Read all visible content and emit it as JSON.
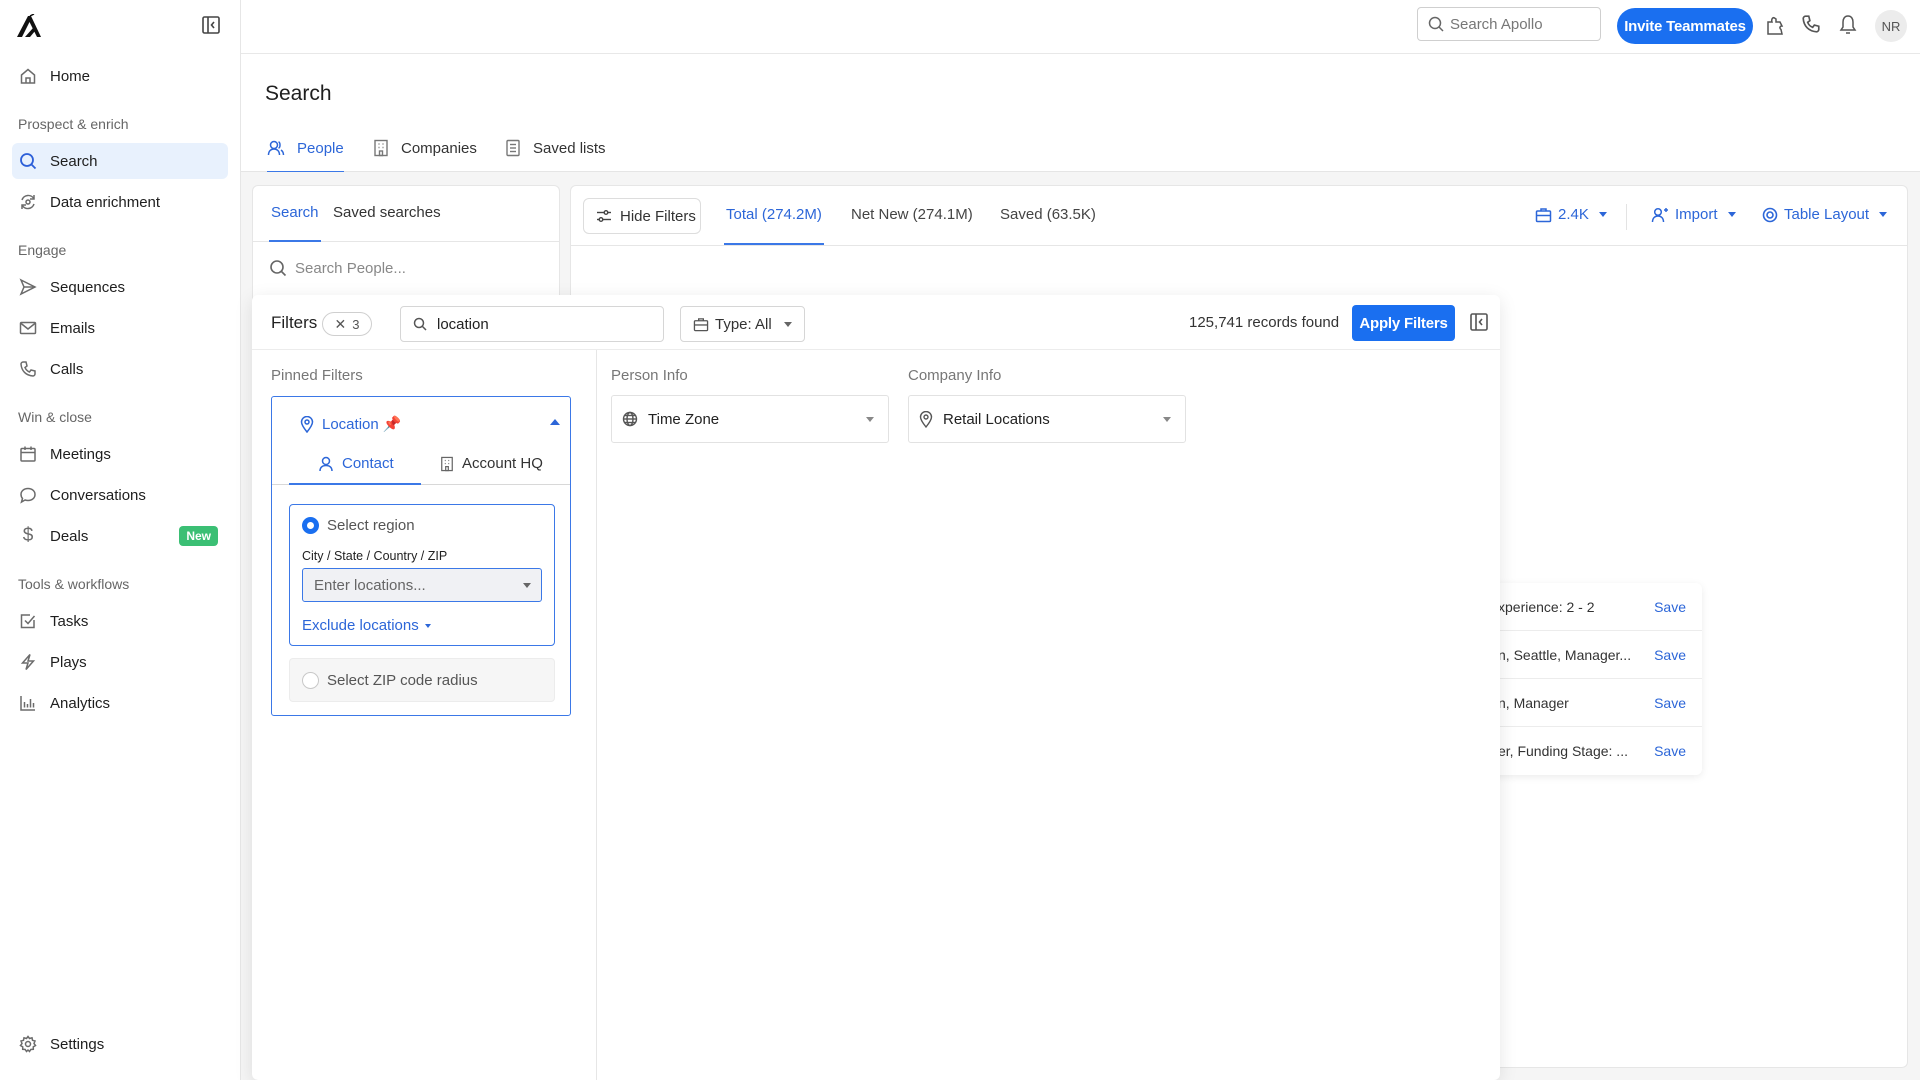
{
  "sidebar": {
    "collapse_label": "Collapse sidebar",
    "home": "Home",
    "sections": {
      "prospect": "Prospect & enrich",
      "engage": "Engage",
      "win": "Win & close",
      "tools": "Tools & workflows"
    },
    "items": {
      "search": "Search",
      "data_enrichment": "Data enrichment",
      "sequences": "Sequences",
      "emails": "Emails",
      "calls": "Calls",
      "meetings": "Meetings",
      "conversations": "Conversations",
      "deals": "Deals",
      "tasks": "Tasks",
      "plays": "Plays",
      "analytics": "Analytics",
      "settings": "Settings"
    },
    "deals_badge": "New",
    "active": "search"
  },
  "topbar": {
    "search_placeholder": "Search Apollo",
    "invite_label": "Invite Teammates",
    "avatar_initials": "NR"
  },
  "page": {
    "title": "Search",
    "tabs": [
      "People",
      "Companies",
      "Saved lists"
    ],
    "active_tab": "People"
  },
  "left_panel": {
    "tabs": [
      "Search",
      "Saved searches"
    ],
    "active_tab": "Search",
    "search_placeholder": "Search People..."
  },
  "toolbar": {
    "hide_filters": "Hide Filters",
    "views": [
      "Total (274.2M)",
      "Net New (274.1M)",
      "Saved (63.5K)"
    ],
    "active_view": "Total (274.2M)",
    "credits": "2.4K",
    "import": "Import",
    "table_layout": "Table Layout"
  },
  "saved_searches": [
    {
      "text": "xperience: 2 - 2",
      "action": "Save"
    },
    {
      "text": "n, Seattle, Manager...",
      "action": "Save"
    },
    {
      "text": "n, Manager",
      "action": "Save"
    },
    {
      "text": "er, Funding Stage: ...",
      "action": "Save"
    }
  ],
  "filters": {
    "title": "Filters",
    "count": "3",
    "search_value": "location",
    "type_label": "Type: All",
    "records_found": "125,741 records found",
    "apply_label": "Apply Filters",
    "pinned_label": "Pinned Filters",
    "location": {
      "title": "Location",
      "tabs": [
        "Contact",
        "Account HQ"
      ],
      "active_tab": "Contact",
      "region_option": "Select region",
      "region_selected": true,
      "field_label": "City / State / Country / ZIP",
      "input_placeholder": "Enter locations...",
      "exclude_label": "Exclude locations",
      "zip_option": "Select ZIP code radius"
    },
    "person_info_label": "Person Info",
    "company_info_label": "Company Info",
    "person_filters": [
      "Time Zone"
    ],
    "company_filters": [
      "Retail Locations"
    ]
  },
  "colors": {
    "accent": "#1a6ff0",
    "link": "#2c66d8",
    "badge_green": "#3bbf74",
    "pin": "#f4b338"
  }
}
